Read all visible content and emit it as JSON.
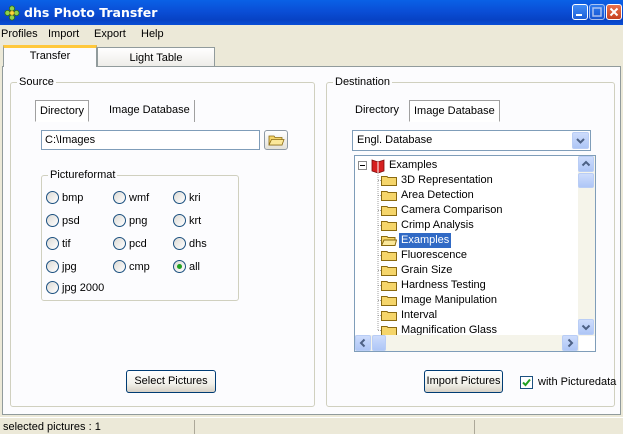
{
  "window": {
    "title": "dhs Photo Transfer"
  },
  "menu": [
    "Profiles",
    "Import",
    "Export",
    "Help"
  ],
  "tabs": [
    {
      "label": "Transfer",
      "active": true
    },
    {
      "label": "Light Table",
      "active": false
    }
  ],
  "source": {
    "label": "Source",
    "subtabs": [
      {
        "label": "Directory",
        "active": true
      },
      {
        "label": "Image Database",
        "active": false
      }
    ],
    "path_value": "C:\\Images",
    "pictureformat": {
      "label": "Pictureformat",
      "options": [
        "bmp",
        "wmf",
        "kri",
        "psd",
        "png",
        "krt",
        "tif",
        "pcd",
        "dhs",
        "jpg",
        "cmp",
        "all",
        "jpg 2000"
      ],
      "selected": "all"
    },
    "select_button": "Select Pictures"
  },
  "destination": {
    "label": "Destination",
    "subtabs": [
      {
        "label": "Directory",
        "active": false
      },
      {
        "label": "Image Database",
        "active": true
      }
    ],
    "database_value": "Engl. Database",
    "tree": {
      "root": "Examples",
      "items": [
        "3D Representation",
        "Area Detection",
        "Camera Comparison",
        "Crimp Analysis",
        "Examples",
        "Fluorescence",
        "Grain Size",
        "Hardness Testing",
        "Image Manipulation",
        "Interval",
        "Magnification Glass"
      ],
      "selected": "Examples"
    },
    "import_button": "Import Pictures",
    "with_picturedata": {
      "label": "with Picturedata",
      "checked": true
    }
  },
  "status": {
    "text": "selected pictures : 1"
  },
  "colors": {
    "titlebar": "#0a4ed6",
    "selection": "#316ac5",
    "tab_highlight": "#ffc83c",
    "radio_dot": "#21a121"
  }
}
